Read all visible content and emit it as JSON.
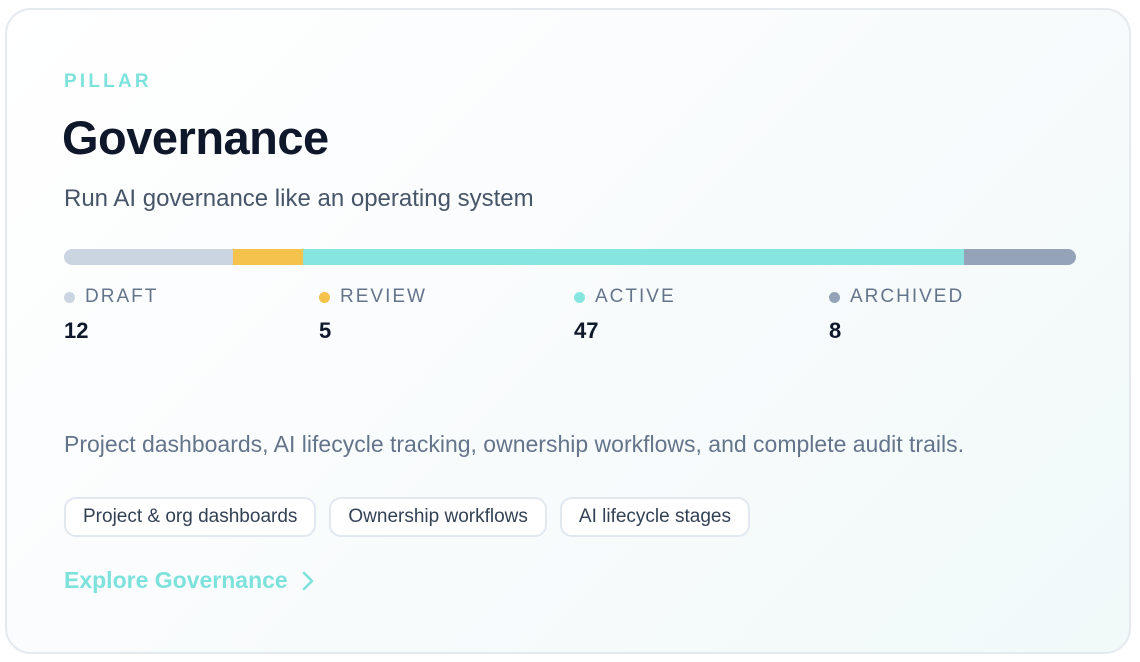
{
  "card": {
    "eyebrow": "PILLAR",
    "title": "Governance",
    "subtitle": "Run AI governance like an operating system",
    "description": "Project dashboards, AI lifecycle tracking, ownership workflows, and complete audit trails.",
    "chips": [
      "Project & org dashboards",
      "Ownership workflows",
      "AI lifecycle stages"
    ],
    "cta_label": "Explore Governance",
    "cta_icon": "chevron-right-icon"
  },
  "status_breakdown": {
    "total": 72,
    "items": [
      {
        "label": "DRAFT",
        "count": "12",
        "value": 12,
        "color": "#cbd5e1"
      },
      {
        "label": "REVIEW",
        "count": "5",
        "value": 5,
        "color": "#f5c24b"
      },
      {
        "label": "ACTIVE",
        "count": "47",
        "value": 47,
        "color": "#86e6df"
      },
      {
        "label": "ARCHIVED",
        "count": "8",
        "value": 8,
        "color": "#94a3b8"
      }
    ]
  }
}
